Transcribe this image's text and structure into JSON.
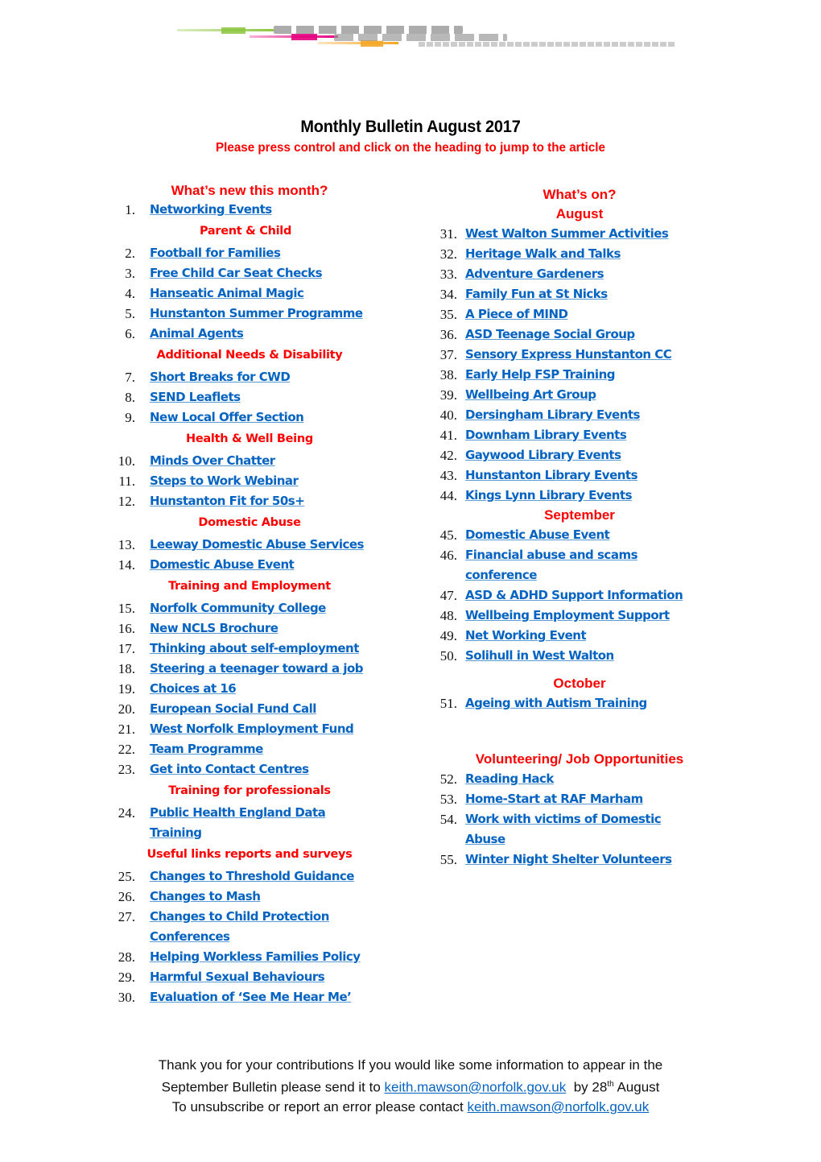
{
  "document": {
    "title": "Monthly Bulletin August 2017",
    "subtitle": "Please press control and click on the heading to jump to the article",
    "logo_alt": "Help Hub logo"
  },
  "colors": {
    "heading_red": "#ff0000",
    "link_blue": "#0563c1"
  },
  "left_column": {
    "heading": "What’s new this month?",
    "sections": [
      {
        "heading": "",
        "items": [
          {
            "n": "1.",
            "label": "Networking Events"
          }
        ]
      },
      {
        "heading": "Parent & Child",
        "items": [
          {
            "n": "2.",
            "label": "Football for Families"
          },
          {
            "n": "3.",
            "label": "Free Child Car Seat Checks"
          },
          {
            "n": "4.",
            "label": "Hanseatic Animal Magic"
          },
          {
            "n": "5.",
            "label": "Hunstanton Summer Programme"
          },
          {
            "n": "6.",
            "label": "Animal Agents"
          }
        ]
      },
      {
        "heading": "Additional Needs & Disability",
        "items": [
          {
            "n": "7.",
            "label": "Short Breaks for CWD"
          },
          {
            "n": "8.",
            "label": "SEND Leaflets"
          },
          {
            "n": "9.",
            "label": "New Local Offer Section"
          }
        ]
      },
      {
        "heading": "Health & Well Being",
        "items": [
          {
            "n": "10.",
            "label": "Minds Over Chatter"
          },
          {
            "n": "11.",
            "label": "Steps to Work Webinar"
          },
          {
            "n": "12.",
            "label": "Hunstanton Fit for 50s+"
          }
        ]
      },
      {
        "heading": "Domestic Abuse",
        "items": [
          {
            "n": "13.",
            "label": "Leeway Domestic Abuse Services"
          },
          {
            "n": "14.",
            "label": "Domestic Abuse Event"
          }
        ]
      },
      {
        "heading": "Training and Employment",
        "items": [
          {
            "n": "15.",
            "label": "Norfolk Community College"
          },
          {
            "n": "16.",
            "label": "New NCLS Brochure"
          },
          {
            "n": "17.",
            "label": "Thinking about self-employment"
          },
          {
            "n": "18.",
            "label": "Steering a teenager toward a job"
          },
          {
            "n": "19.",
            "label": "Choices at 16"
          },
          {
            "n": "20.",
            "label": "European Social Fund Call"
          },
          {
            "n": "21.",
            "label": "West Norfolk Employment Fund"
          },
          {
            "n": "22.",
            "label": "Team Programme"
          },
          {
            "n": "23.",
            "label": "Get into Contact Centres"
          }
        ]
      },
      {
        "heading": "Training for professionals",
        "items": [
          {
            "n": "24.",
            "label": "Public Health England Data",
            "label2": "Training"
          }
        ]
      },
      {
        "heading": "Useful links reports and surveys",
        "items": [
          {
            "n": "25.",
            "label": "Changes to Threshold Guidance"
          },
          {
            "n": "26.",
            "label": "Changes to Mash"
          },
          {
            "n": "27.",
            "label": "Changes to Child Protection",
            "label2": "Conferences"
          },
          {
            "n": "28.",
            "label": "Helping Workless Families Policy"
          },
          {
            "n": "29.",
            "label": "Harmful Sexual Behaviours"
          },
          {
            "n": "30.",
            "label": "Evaluation of ‘See Me Hear Me’"
          }
        ]
      }
    ]
  },
  "right_column": {
    "heading": "What’s on?",
    "sections": [
      {
        "heading": "August",
        "items": [
          {
            "n": "31.",
            "label": "West Walton Summer Activities"
          },
          {
            "n": "32.",
            "label": "Heritage Walk and Talks"
          },
          {
            "n": "33.",
            "label": "Adventure Gardeners"
          },
          {
            "n": "34.",
            "label": "Family Fun at St Nicks"
          },
          {
            "n": "35.",
            "label": "A Piece of MIND"
          },
          {
            "n": "36.",
            "label": "ASD Teenage Social Group"
          },
          {
            "n": "37.",
            "label": "Sensory Express Hunstanton CC"
          },
          {
            "n": "38.",
            "label": "Early Help FSP Training"
          },
          {
            "n": "39.",
            "label": "Wellbeing Art Group"
          },
          {
            "n": "40.",
            "label": "Dersingham Library Events"
          },
          {
            "n": "41.",
            "label": "Downham Library Events"
          },
          {
            "n": "42.",
            "label": "Gaywood Library Events"
          },
          {
            "n": "43.",
            "label": "Hunstanton Library Events"
          },
          {
            "n": "44.",
            "label": "Kings Lynn Library Events"
          }
        ]
      },
      {
        "heading": "September",
        "items": [
          {
            "n": "45.",
            "label": "Domestic Abuse Event"
          },
          {
            "n": "46.",
            "label": "Financial abuse and scams",
            "label2": "conference"
          },
          {
            "n": "47.",
            "label": "ASD & ADHD Support Information"
          },
          {
            "n": "48.",
            "label": "Wellbeing Employment Support"
          },
          {
            "n": "49.",
            "label": "Net Working Event"
          },
          {
            "n": "50.",
            "label": "Solihull in West Walton"
          }
        ]
      },
      {
        "heading": "October",
        "items": [
          {
            "n": "51.",
            "label": "Ageing with Autism Training"
          }
        ]
      },
      {
        "heading": "Volunteering/ Job Opportunities",
        "items": [
          {
            "n": "52.",
            "label": "Reading Hack"
          },
          {
            "n": "53.",
            "label": "Home-Start at RAF Marham"
          },
          {
            "n": "54.",
            "label": "Work with victims of Domestic",
            "label2": "Abuse"
          },
          {
            "n": "55.",
            "label": "Winter Night Shelter Volunteers"
          }
        ]
      }
    ]
  },
  "footer": {
    "line1": "Thank you for your contributions If you would like some information to appear in the",
    "line2_pre": "September Bulletin please send it to ",
    "email": "keith.mawson@norfolk.gov.uk",
    "line2_mid": "  by 28",
    "line2_sup": "th",
    "line2_post": " August",
    "line3_pre": "To unsubscribe or report an error please contact "
  }
}
